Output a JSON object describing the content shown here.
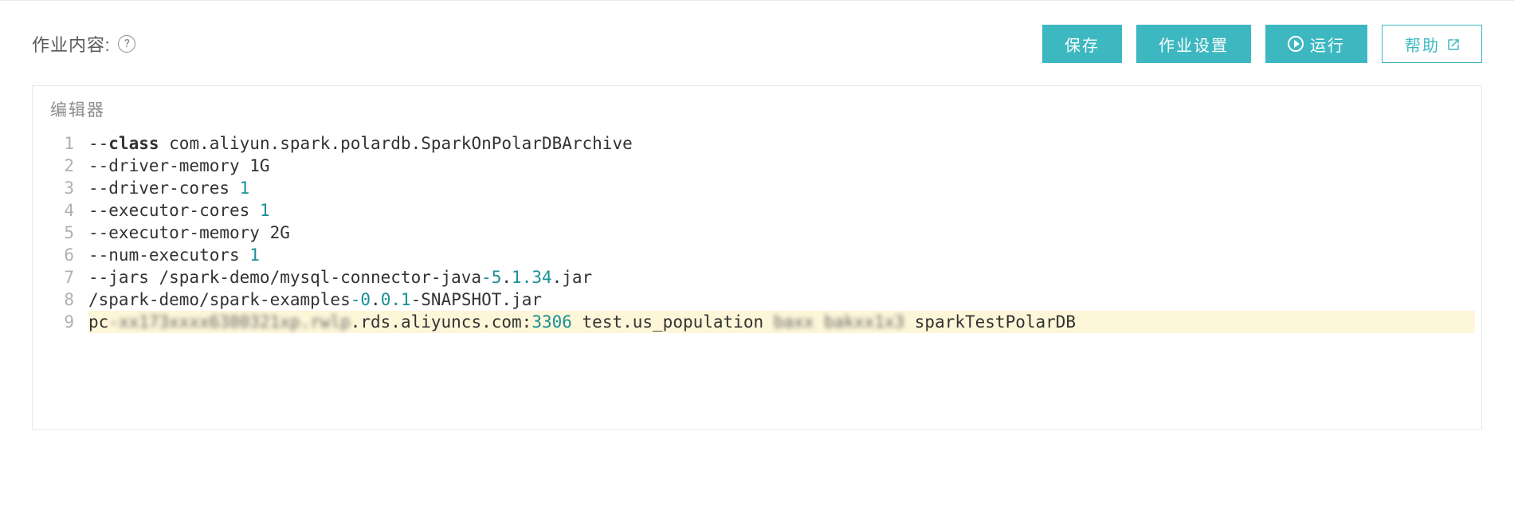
{
  "header": {
    "title": "作业内容:",
    "help_symbol": "?"
  },
  "buttons": {
    "save": "保存",
    "job_settings": "作业设置",
    "run": "运行",
    "help": "帮助"
  },
  "editor": {
    "label": "编辑器",
    "lines": [
      {
        "num": "1",
        "parts": [
          {
            "text": "--",
            "cls": ""
          },
          {
            "text": "class",
            "cls": "tok-bold"
          },
          {
            "text": " com.aliyun.spark.polardb.SparkOnPolarDBArchive",
            "cls": ""
          }
        ]
      },
      {
        "num": "2",
        "parts": [
          {
            "text": "--driver-memory 1G",
            "cls": ""
          }
        ]
      },
      {
        "num": "3",
        "parts": [
          {
            "text": "--driver-cores ",
            "cls": ""
          },
          {
            "text": "1",
            "cls": "tok-num"
          }
        ]
      },
      {
        "num": "4",
        "parts": [
          {
            "text": "--executor-cores ",
            "cls": ""
          },
          {
            "text": "1",
            "cls": "tok-num"
          }
        ]
      },
      {
        "num": "5",
        "parts": [
          {
            "text": "--executor-memory 2G",
            "cls": ""
          }
        ]
      },
      {
        "num": "6",
        "parts": [
          {
            "text": "--num-executors ",
            "cls": ""
          },
          {
            "text": "1",
            "cls": "tok-num"
          }
        ]
      },
      {
        "num": "7",
        "parts": [
          {
            "text": "--jars /spark-demo/mysql-connector-java",
            "cls": ""
          },
          {
            "text": "-5",
            "cls": "tok-dash"
          },
          {
            "text": ".",
            "cls": ""
          },
          {
            "text": "1.34",
            "cls": "tok-num"
          },
          {
            "text": ".jar",
            "cls": ""
          }
        ]
      },
      {
        "num": "8",
        "parts": [
          {
            "text": "/spark-demo/spark-examples",
            "cls": ""
          },
          {
            "text": "-0",
            "cls": "tok-dash"
          },
          {
            "text": ".",
            "cls": ""
          },
          {
            "text": "0.1",
            "cls": "tok-num"
          },
          {
            "text": "-SNAPSHOT.jar",
            "cls": ""
          }
        ]
      },
      {
        "num": "9",
        "highlighted": true,
        "parts": [
          {
            "text": "pc",
            "cls": ""
          },
          {
            "text": "-xx173xxxx6380321xp.rwlp",
            "cls": "blurred"
          },
          {
            "text": ".rds.aliyuncs.com:",
            "cls": ""
          },
          {
            "text": "3306",
            "cls": "tok-num"
          },
          {
            "text": " test.us_population ",
            "cls": ""
          },
          {
            "text": "baxx bakxx1x3",
            "cls": "blurred"
          },
          {
            "text": " sparkTestPolarDB",
            "cls": ""
          }
        ]
      }
    ]
  }
}
